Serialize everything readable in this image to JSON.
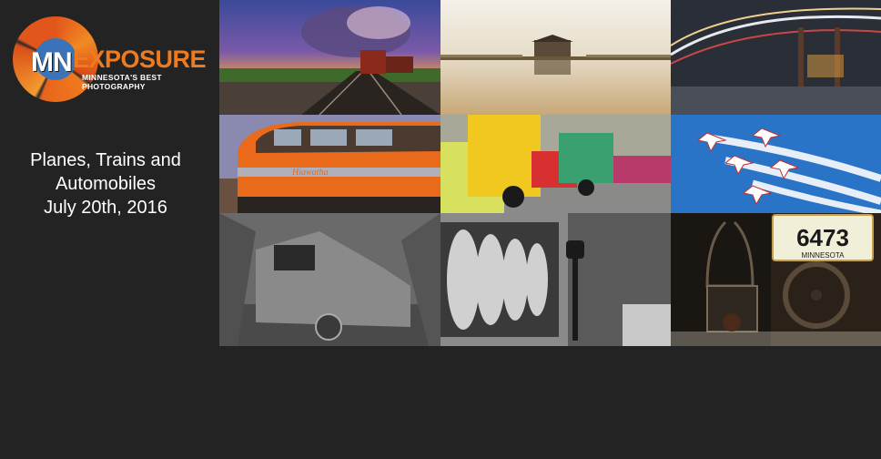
{
  "logo": {
    "mn": "MN",
    "exposure": "EXPOSURE",
    "tagline": "MINNESOTA'S BEST PHOTOGRAPHY"
  },
  "title": {
    "line1": "Planes, Trains and",
    "line2": "Automobiles",
    "date": "July 20th, 2016"
  },
  "photos": {
    "train_sign": "Hiawatha",
    "license_plate": "6473",
    "plate_state": "MINNESOTA"
  },
  "colors": {
    "background": "#232323",
    "brand_orange": "#f07a1e",
    "brand_blue": "#3b73b9"
  }
}
